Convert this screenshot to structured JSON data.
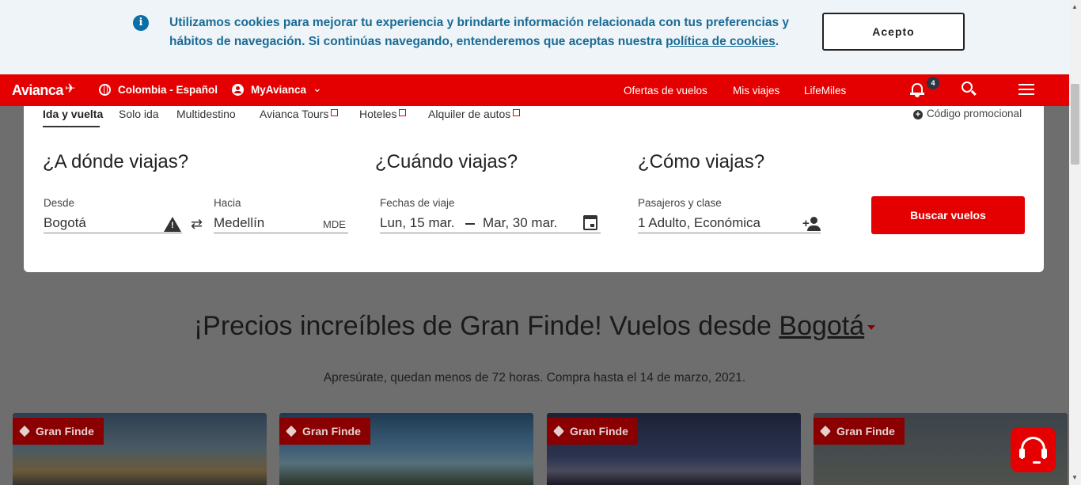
{
  "cookie_banner": {
    "message": "Utilizamos cookies para mejorar tu experiencia y brindarte información relacionada con tus preferencias y hábitos de navegación. Si continúas navegando, entenderemos que aceptas nuestra ",
    "link_text": "política de cookies",
    "suffix": ".",
    "accept_label": "Acepto",
    "info_icon": "info-icon"
  },
  "navbar": {
    "logo": "Avianca",
    "country_language": "Colombia - Español",
    "account": "MyAvianca",
    "links": [
      "Ofertas de vuelos",
      "Mis viajes",
      "LifeMiles"
    ],
    "notification_count": "4",
    "color": "#e40000"
  },
  "search": {
    "tabs": [
      "Ida y vuelta",
      "Solo ida",
      "Multidestino",
      "Avianca Tours",
      "Hoteles",
      "Alquiler de autos"
    ],
    "promo_label": "Código promocional",
    "where_title": "¿A dónde viajas?",
    "when_title": "¿Cuándo viajas?",
    "how_title": "¿Cómo viajas?",
    "from_label": "Desde",
    "from_value": "Bogotá",
    "to_label": "Hacia",
    "to_value": "Medellín",
    "to_code": "MDE",
    "dates_label": "Fechas de viaje",
    "date_start": "Lun, 15 mar.",
    "date_end": "Mar, 30 mar.",
    "passengers_label": "Pasajeros y clase",
    "passengers_value": "1 Adulto, Económica",
    "search_button": "Buscar vuelos"
  },
  "deals": {
    "title_prefix": "¡Precios increíbles de Gran Finde! Vuelos desde ",
    "title_city": "Bogotá",
    "subtitle": "Apresúrate, quedan menos de 72 horas. Compra hasta el 14 de marzo, 2021.",
    "cards": [
      {
        "tag": "Gran Finde"
      },
      {
        "tag": "Gran Finde"
      },
      {
        "tag": "Gran Finde"
      },
      {
        "tag": "Gran Finde"
      }
    ]
  }
}
